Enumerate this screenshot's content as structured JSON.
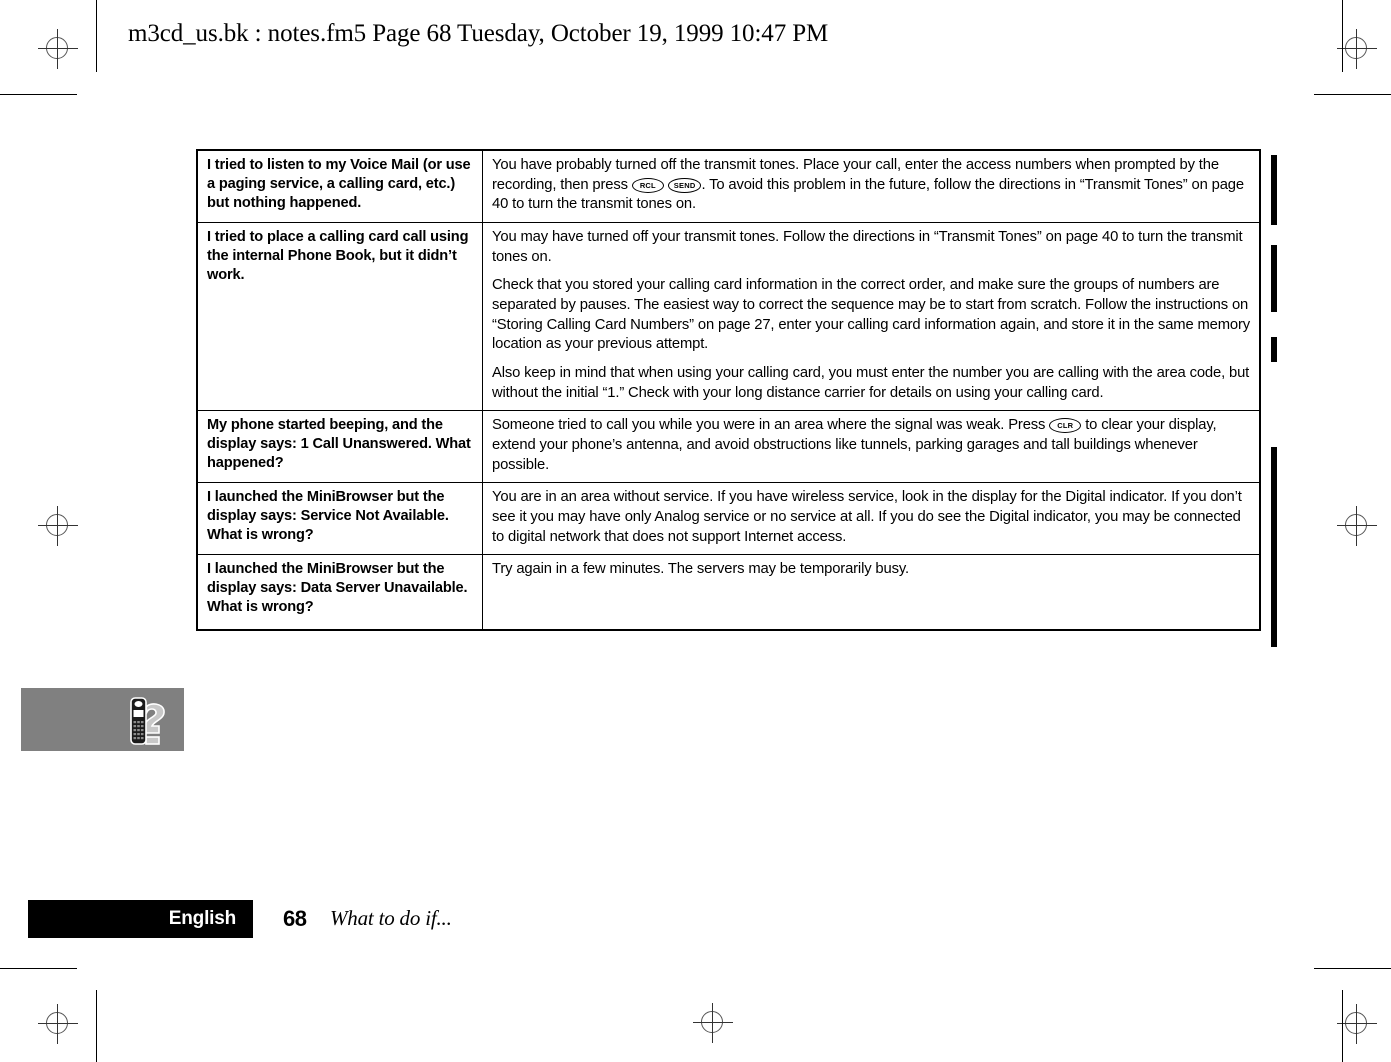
{
  "doc_header": "m3cd_us.bk : notes.fm5  Page 68  Tuesday, October 19, 1999  10:47 PM",
  "keys": {
    "rcl": "RCL",
    "send": "SEND",
    "clr": "CLR"
  },
  "table": {
    "rows": [
      {
        "question": "I tried to listen to my Voice Mail (or use a paging service, a calling card, etc.) but nothing happened.",
        "answer_parts": [
          {
            "type": "text",
            "value": "You have probably turned off the transmit tones. Place your call, enter the access numbers when prompted by the recording, then press "
          },
          {
            "type": "key",
            "value": "RCL"
          },
          {
            "type": "text",
            "value": " "
          },
          {
            "type": "key",
            "value": "SEND"
          },
          {
            "type": "text",
            "value": ". To avoid this problem in the future, follow the directions in “Transmit Tones” on page 40 to turn the transmit tones on."
          }
        ]
      },
      {
        "question": "I tried to place a calling card call using the internal Phone Book, but it didn’t work.",
        "paragraphs": [
          "You may have turned off your transmit tones. Follow the directions in “Transmit Tones” on page 40 to turn the transmit tones on.",
          "Check that you stored your calling card information in the correct order, and make sure the groups of numbers are separated by pauses. The easiest way to correct the sequence may be to start from scratch. Follow the instructions on “Storing Calling Card Numbers” on page 27, enter your calling card information again, and store it in the same memory location as your previous attempt.",
          "Also keep in mind that when using your calling card, you must enter the number you are calling with the area code, but without the initial “1.” Check with your long distance carrier for details on using your calling card."
        ]
      },
      {
        "question": "My phone started beeping, and the display says: 1 Call Unanswered. What happened?",
        "answer_parts": [
          {
            "type": "text",
            "value": "Someone tried to call you while you were in an area where the signal was weak. Press "
          },
          {
            "type": "key",
            "value": "CLR"
          },
          {
            "type": "text",
            "value": " to clear your display, extend your phone’s antenna, and avoid obstructions like tunnels, parking garages and tall buildings whenever possible."
          }
        ]
      },
      {
        "question": "I launched the MiniBrowser but the display says: Service Not Available. What is wrong?",
        "answer": "You are in an area without service. If you have wireless service, look in the display for the Digital indicator. If you don’t see it you may have only Analog service or no service at all. If you do see the Digital indicator, you may be connected to digital network that does not support Internet access."
      },
      {
        "question": "I launched the MiniBrowser but the display says: Data Server Unavailable. What is wrong?",
        "answer": "Try again in a few minutes. The servers may be temporarily busy."
      }
    ]
  },
  "footer": {
    "language": "English",
    "page_number": "68",
    "section_title": "What to do if..."
  },
  "colors": {
    "icon_box_background": "#808080",
    "language_tab_background": "#000000",
    "rule": "#000000"
  }
}
